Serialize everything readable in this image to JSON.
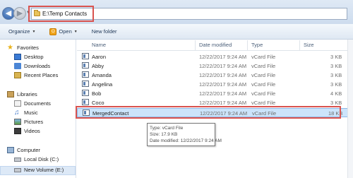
{
  "address": {
    "path": "E:\\Temp Contacts"
  },
  "toolbar": {
    "organize_label": "Organize",
    "open_label": "Open",
    "new_folder_label": "New folder"
  },
  "navigation": {
    "favorites": "Favorites",
    "desktop": "Desktop",
    "downloads": "Downloads",
    "recent_places": "Recent Places",
    "libraries": "Libraries",
    "documents": "Documents",
    "music": "Music",
    "pictures": "Pictures",
    "videos": "Videos",
    "computer": "Computer",
    "local_disk": "Local Disk (C:)",
    "new_volume": "New Volume (E:)"
  },
  "columns": {
    "name": "Name",
    "date_modified": "Date modified",
    "type": "Type",
    "size": "Size"
  },
  "files": [
    {
      "name": "Aaron",
      "date": "12/22/2017 9:24 AM",
      "type": "vCard File",
      "size": "3 KB"
    },
    {
      "name": "Abby",
      "date": "12/22/2017 9:24 AM",
      "type": "vCard File",
      "size": "3 KB"
    },
    {
      "name": "Amanda",
      "date": "12/22/2017 9:24 AM",
      "type": "vCard File",
      "size": "3 KB"
    },
    {
      "name": "Angelina",
      "date": "12/22/2017 9:24 AM",
      "type": "vCard File",
      "size": "3 KB"
    },
    {
      "name": "Bob",
      "date": "12/22/2017 9:24 AM",
      "type": "vCard File",
      "size": "4 KB"
    },
    {
      "name": "Coco",
      "date": "12/22/2017 9:24 AM",
      "type": "vCard File",
      "size": "3 KB"
    },
    {
      "name": "MergedContact",
      "date": "12/22/2017 9:24 AM",
      "type": "vCard File",
      "size": "18 KB"
    }
  ],
  "tooltip": {
    "type_line": "Type: vCard File",
    "size_line": "Size: 17.9 KB",
    "date_line": "Date modified: 12/22/2017 9:24 AM"
  },
  "colors": {
    "highlight": "#d9534f",
    "selection": "#cce4fb"
  }
}
